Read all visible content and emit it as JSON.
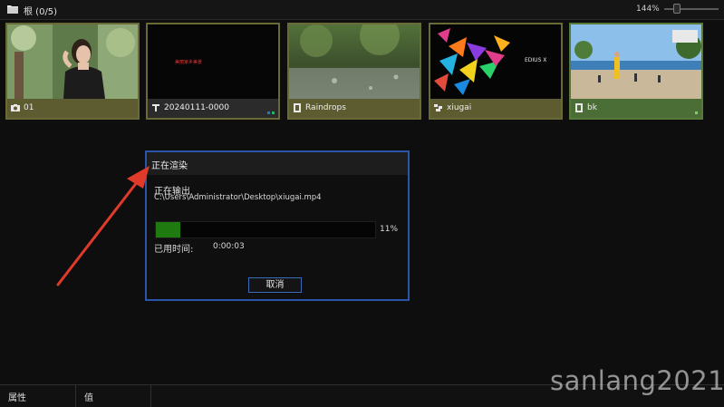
{
  "header": {
    "title": "根 (0/5)",
    "folder_icon": "folder-icon",
    "zoom": "144%",
    "zoom_slider_value": 0.2
  },
  "clips": [
    {
      "name": "01",
      "type_icon": "camera-icon",
      "selected": false,
      "thumb": "photo of a woman among leaves"
    },
    {
      "name": "20240111-0000",
      "type_icon": "text-icon",
      "selected": false,
      "thumb_text": "美丽家乡美景",
      "badges": [
        "#1a7fc0",
        "#29b06a"
      ]
    },
    {
      "name": "Raindrops",
      "type_icon": "video-icon",
      "selected": false
    },
    {
      "name": "xiugai",
      "type_icon": "sequence-icon",
      "selected": false,
      "thumb_text": "EDIUS X"
    },
    {
      "name": "bk",
      "type_icon": "video-icon",
      "selected": true,
      "badges": [
        "#7fd16a"
      ]
    }
  ],
  "dialog": {
    "title": "正在渲染",
    "status": "正在输出",
    "path": "C:\\Users\\Administrator\\Desktop\\xiugai.mp4",
    "progress_percent": 11,
    "progress_text": "11%",
    "elapsed_label": "已用时间:",
    "elapsed_value": "0:00:03",
    "cancel_label": "取消"
  },
  "bottom": {
    "col1": "属性",
    "col2": "值"
  },
  "watermark": "sanlang2021",
  "colors": {
    "accent_border": "#2a55a8",
    "progress_fill": "#1f7a10",
    "clip_label": "#5d5c30",
    "clip_selected": "#4a6e36",
    "annotation_arrow": "#e03a2a"
  }
}
